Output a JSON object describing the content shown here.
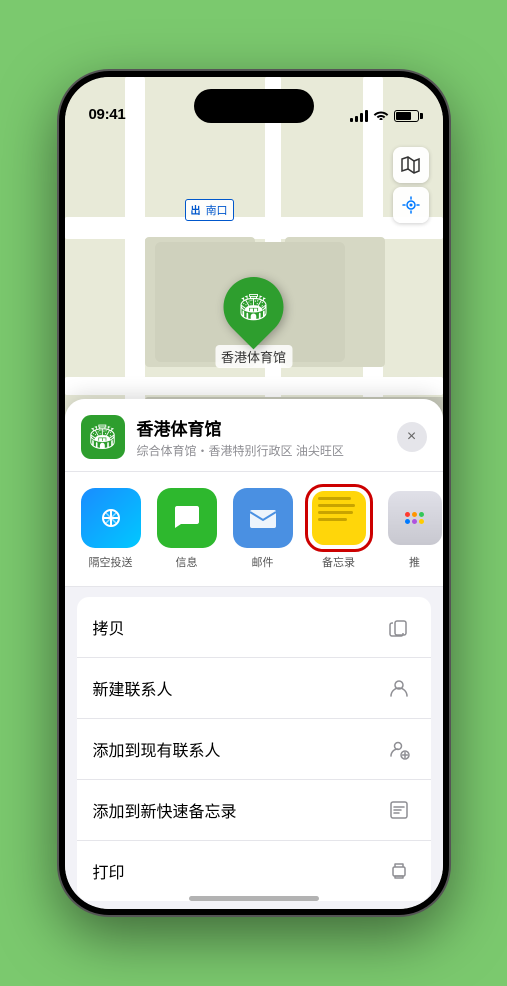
{
  "status_bar": {
    "time": "09:41",
    "location_arrow": "▶"
  },
  "map": {
    "entrance_label": "南口",
    "entrance_tag": "出",
    "location_name": "香港体育馆"
  },
  "map_buttons": {
    "map_icon": "🗺",
    "location_icon": "➤"
  },
  "sheet": {
    "venue_name": "香港体育馆",
    "venue_subtitle": "综合体育馆・香港特别行政区 油尖旺区",
    "close_label": "×"
  },
  "share_items": [
    {
      "id": "airdrop",
      "label": "隔空投送",
      "selected": false
    },
    {
      "id": "messages",
      "label": "信息",
      "selected": false
    },
    {
      "id": "mail",
      "label": "邮件",
      "selected": false
    },
    {
      "id": "notes",
      "label": "备忘录",
      "selected": true
    },
    {
      "id": "more",
      "label": "推",
      "selected": false
    }
  ],
  "actions": [
    {
      "label": "拷贝",
      "icon": "copy"
    },
    {
      "label": "新建联系人",
      "icon": "person"
    },
    {
      "label": "添加到现有联系人",
      "icon": "person-add"
    },
    {
      "label": "添加到新快速备忘录",
      "icon": "note"
    },
    {
      "label": "打印",
      "icon": "print"
    }
  ]
}
